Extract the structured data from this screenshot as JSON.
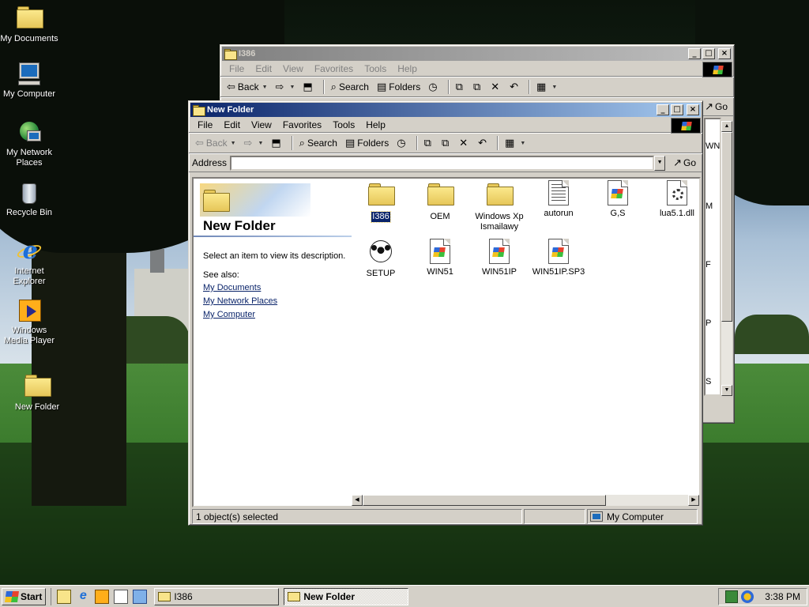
{
  "desktop": {
    "icons": [
      {
        "label": "My Documents"
      },
      {
        "label": "My Computer"
      },
      {
        "label": "My Network Places"
      },
      {
        "label": "Recycle Bin"
      },
      {
        "label": "Internet Explorer"
      },
      {
        "label": "Windows Media Player"
      },
      {
        "label": "New Folder"
      }
    ]
  },
  "back_window": {
    "title": "I386",
    "menu": [
      "File",
      "Edit",
      "View",
      "Favorites",
      "Tools",
      "Help"
    ],
    "toolbar": {
      "back": "Back",
      "search": "Search",
      "folders": "Folders"
    },
    "go_label": "Go",
    "peek_letters": [
      "WN",
      "M",
      "F",
      "P",
      "S"
    ]
  },
  "front_window": {
    "title": "New Folder",
    "menu": [
      "File",
      "Edit",
      "View",
      "Favorites",
      "Tools",
      "Help"
    ],
    "toolbar": {
      "back": "Back",
      "search": "Search",
      "folders": "Folders"
    },
    "address_label": "Address",
    "address_value": "",
    "go_label": "Go",
    "description": {
      "title": "New Folder",
      "text": "Select an item to view its description.",
      "see_also": "See also:",
      "links": [
        "My Documents",
        "My Network Places",
        "My Computer"
      ]
    },
    "files": [
      {
        "label": "I386",
        "icon": "folder-icon",
        "selected": true
      },
      {
        "label": "OEM",
        "icon": "folder-icon"
      },
      {
        "label": "Windows Xp Ismailawy",
        "icon": "folder-icon"
      },
      {
        "label": "autorun",
        "icon": "autorun-icon"
      },
      {
        "label": "G,S",
        "icon": "windows-file-icon"
      },
      {
        "label": "lua5.1.dll",
        "icon": "dll-icon"
      },
      {
        "label": "SETUP",
        "icon": "soccer-ball-icon"
      },
      {
        "label": "WIN51",
        "icon": "windows-file-icon"
      },
      {
        "label": "WIN51IP",
        "icon": "windows-file-icon"
      },
      {
        "label": "WIN51IP.SP3",
        "icon": "windows-file-icon"
      }
    ],
    "status": {
      "selected": "1 object(s) selected",
      "zone": "My Computer"
    }
  },
  "taskbar": {
    "start_label": "Start",
    "tasks": [
      {
        "label": "I386",
        "active": false
      },
      {
        "label": "New Folder",
        "active": true
      }
    ],
    "clock": "3:38 PM"
  },
  "colors": {
    "title_active": "#0a246a",
    "title_inactive": "#808080",
    "face": "#d4d0c8",
    "link": "#0a246a"
  }
}
